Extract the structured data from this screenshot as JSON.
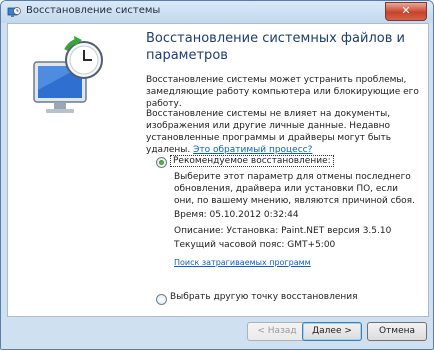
{
  "window": {
    "title": "Восстановление системы",
    "close_glyph": "✕"
  },
  "header": {
    "heading": "Восстановление системных файлов и параметров"
  },
  "intro": {
    "p1": "Восстановление системы может устранить проблемы, замедляющие работу компьютера или блокирующие его работу.",
    "p2_text": "Восстановление системы не влияет на документы, изображения или другие личные данные. Недавно установленные программы и драйверы могут быть удалены. ",
    "p2_link": "Это обратимый процесс?"
  },
  "options": {
    "recommended": {
      "label": "Рекомендуемое восстановление:",
      "selected": true,
      "description": "Выберите этот параметр для отмены последнего обновления, драйвера или установки ПО, если они, по вашему мнению, являются причиной сбоя.",
      "time": "Время: 05.10.2012 0:32:44",
      "desc_line": "Описание: Установка: Paint.NET версия 3.5.10",
      "timezone": "Текущий часовой пояс: GMT+5:00",
      "affected_link": "Поиск затрагиваемых программ"
    },
    "other": {
      "label": "Выбрать другую точку восстановления",
      "selected": false
    }
  },
  "buttons": {
    "back": "< Назад",
    "next": "Далее >",
    "cancel": "Отмена"
  }
}
